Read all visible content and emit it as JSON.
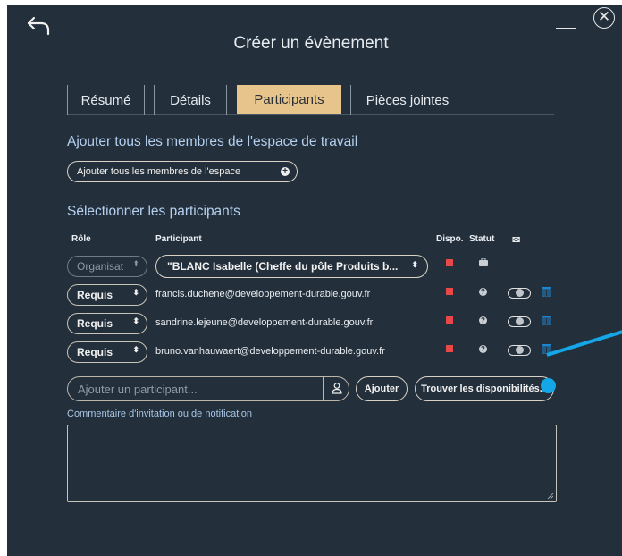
{
  "header": {
    "title": "Créer un évènement",
    "back_icon": "undo-arrow-icon",
    "minimize_icon": "minimize-icon",
    "close_icon": "close-circle-icon",
    "close_glyph": "✕"
  },
  "tabs": [
    {
      "label": "Résumé"
    },
    {
      "label": "Détails"
    },
    {
      "label": "Participants",
      "active": true
    },
    {
      "label": "Pièces jointes"
    }
  ],
  "workspace": {
    "heading": "Ajouter tous les membres de l'espace de travail",
    "button_label": "Ajouter tous les membres de l'espace",
    "plus": "+"
  },
  "participants": {
    "heading": "Sélectionner les participants",
    "columns": {
      "role": "Rôle",
      "participant": "Participant",
      "dispo": "Dispo.",
      "statut": "Statut",
      "mail_icon": "envelope-icon",
      "mail_glyph": "✉"
    },
    "organizer": {
      "role": "Organisateur",
      "role_display": "Organisat",
      "participant": "\"BLANC Isabelle (Cheffe du pôle Produits b..."
    },
    "rows": [
      {
        "role": "Requis",
        "email": "francis.duchene@developpement-durable.gouv.fr"
      },
      {
        "role": "Requis",
        "email": "sandrine.lejeune@developpement-durable.gouv.fr"
      },
      {
        "role": "Requis",
        "email": "bruno.vanhauwaert@developpement-durable.gouv.fr"
      }
    ],
    "status_glyph": "?",
    "sort_arrows": "⬍"
  },
  "add": {
    "placeholder": "Ajouter un participant...",
    "add_label": "Ajouter",
    "find_label": "Trouver les disponibilités..."
  },
  "comment": {
    "label": "Commentaire d'invitation ou de notification",
    "value": ""
  },
  "colors": {
    "background": "#232f3b",
    "accent": "#e6c48c",
    "dispo_red": "#e84848",
    "link_blue": "#14a6e6"
  }
}
